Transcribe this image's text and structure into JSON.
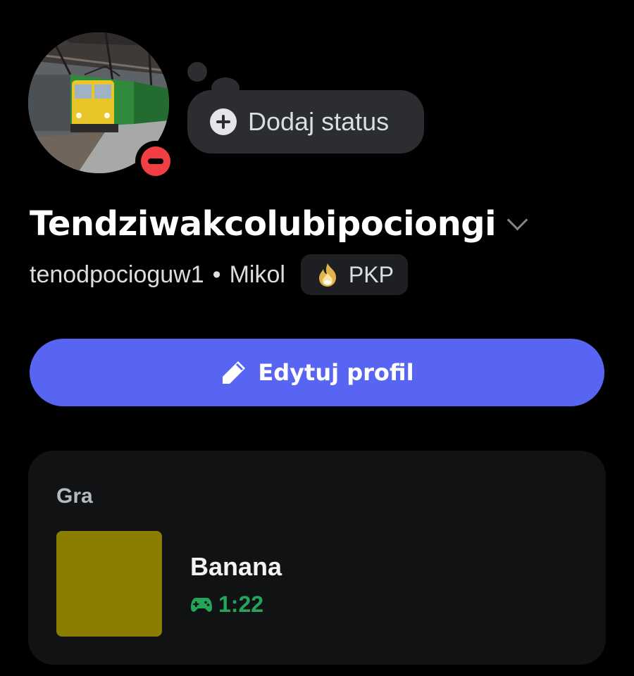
{
  "profile": {
    "display_name": "Tendziwakcolubipociongi",
    "username": "tenodpocioguw1",
    "separator": "•",
    "pronouns": "Mikol",
    "guild_tag": {
      "text": "PKP",
      "icon": "flame-icon"
    },
    "avatar_subject": "train-photo",
    "presence_status": "do-not-disturb"
  },
  "status_bubble": {
    "label": "Dodaj status",
    "icon": "plus-circle-icon"
  },
  "edit_profile": {
    "label": "Edytuj profil",
    "icon": "pencil-icon"
  },
  "activity": {
    "title": "Gra",
    "game_name": "Banana",
    "elapsed": "1:22",
    "icon": "controller-icon"
  },
  "colors": {
    "background": "#000000",
    "accent": "#5865f2",
    "dnd": "#f23f43",
    "elapsed_green": "#23a55a",
    "game_art": "#8b7d00"
  }
}
